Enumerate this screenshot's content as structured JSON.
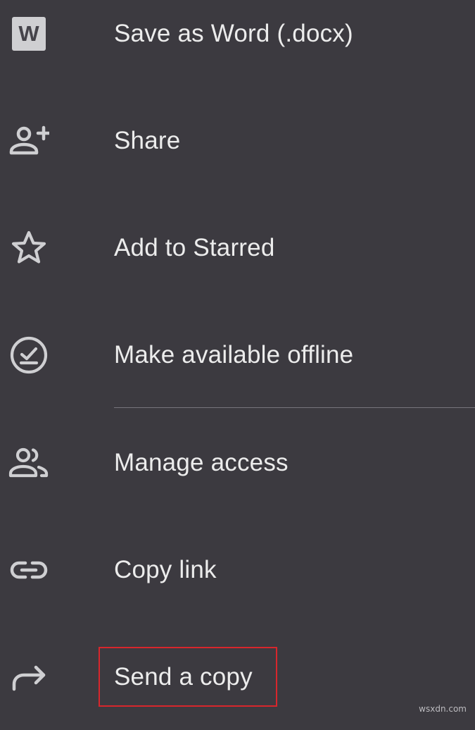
{
  "menu": {
    "items": [
      {
        "id": "save-as-word",
        "label": "Save as Word (.docx)",
        "icon": "word-icon",
        "badge": "W"
      },
      {
        "id": "share",
        "label": "Share",
        "icon": "person-add-icon"
      },
      {
        "id": "add-to-starred",
        "label": "Add to Starred",
        "icon": "star-icon"
      },
      {
        "id": "make-available-offline",
        "label": "Make available offline",
        "icon": "offline-check-icon"
      },
      {
        "id": "manage-access",
        "label": "Manage access",
        "icon": "people-icon"
      },
      {
        "id": "copy-link",
        "label": "Copy link",
        "icon": "link-icon"
      },
      {
        "id": "send-a-copy",
        "label": "Send a copy",
        "icon": "forward-arrow-icon",
        "highlighted": true
      }
    ]
  },
  "colors": {
    "background": "#3c3a40",
    "text": "#ececec",
    "icon": "#cfcfd2",
    "divider": "#77757c",
    "highlight": "#d8262c"
  },
  "watermark": "wsxdn.com"
}
